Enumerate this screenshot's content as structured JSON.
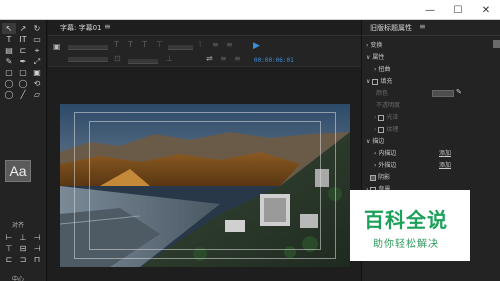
{
  "window": {
    "minimize_glyph": "—",
    "maximize_glyph": "☐",
    "close_glyph": "✕"
  },
  "editor": {
    "title": "字幕: 字幕01",
    "menu_glyph": "≡",
    "timecode": "00:00:06:01"
  },
  "tools": {
    "glyphs": [
      "↖",
      "↗",
      "↻",
      "T",
      "IT",
      "▭",
      "▤",
      "⊏",
      "⌖",
      "✎",
      "✒",
      "⤢",
      "▢",
      "▢",
      "▣",
      "◯",
      "◯",
      "⟲",
      "◯",
      "╱",
      "▱"
    ],
    "sample_text": "Aa",
    "align_label": "对齐",
    "align_glyphs": [
      "⊢",
      "⊥",
      "⊣",
      "⊤",
      "⊟",
      "⊣",
      "⊏",
      "⊐",
      "⊓"
    ],
    "center_label": "中心"
  },
  "properties": {
    "title": "旧版标题属性",
    "menu_glyph": "≡",
    "rows": [
      {
        "label": "变换",
        "prefix": "›"
      },
      {
        "label": "属性",
        "prefix": "∨"
      },
      {
        "label": "扭曲",
        "prefix": "›"
      },
      {
        "label": "填充",
        "prefix": "∨"
      },
      {
        "label": "颜色",
        "prefix": ""
      },
      {
        "label": "不透明度",
        "prefix": ""
      },
      {
        "label": "光泽",
        "prefix": "›"
      },
      {
        "label": "纹理",
        "prefix": "›"
      },
      {
        "label": "描边",
        "prefix": "∨"
      },
      {
        "label": "内描边",
        "prefix": "›"
      },
      {
        "label": "外描边",
        "prefix": "›"
      },
      {
        "label": "阴影",
        "prefix": ""
      },
      {
        "label": "背景",
        "prefix": "›"
      }
    ],
    "add_label_1": "添加",
    "add_label_2": "添加"
  },
  "watermark": {
    "title": "百科全说",
    "subtitle": "助你轻松解决"
  },
  "colors": {
    "accent_blue": "#3b8fd8",
    "watermark_green": "#1ca05a"
  }
}
